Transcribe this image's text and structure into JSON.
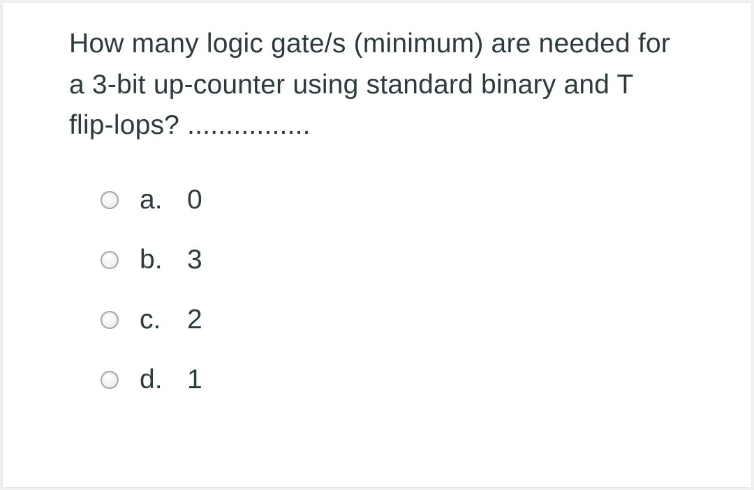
{
  "question": {
    "text": "How many logic gate/s (minimum) are needed for a 3-bit up-counter using standard binary and T flip-lops? ................"
  },
  "options": [
    {
      "label": "a.",
      "value": "0"
    },
    {
      "label": "b.",
      "value": "3"
    },
    {
      "label": "c.",
      "value": "2"
    },
    {
      "label": "d.",
      "value": "1"
    }
  ]
}
